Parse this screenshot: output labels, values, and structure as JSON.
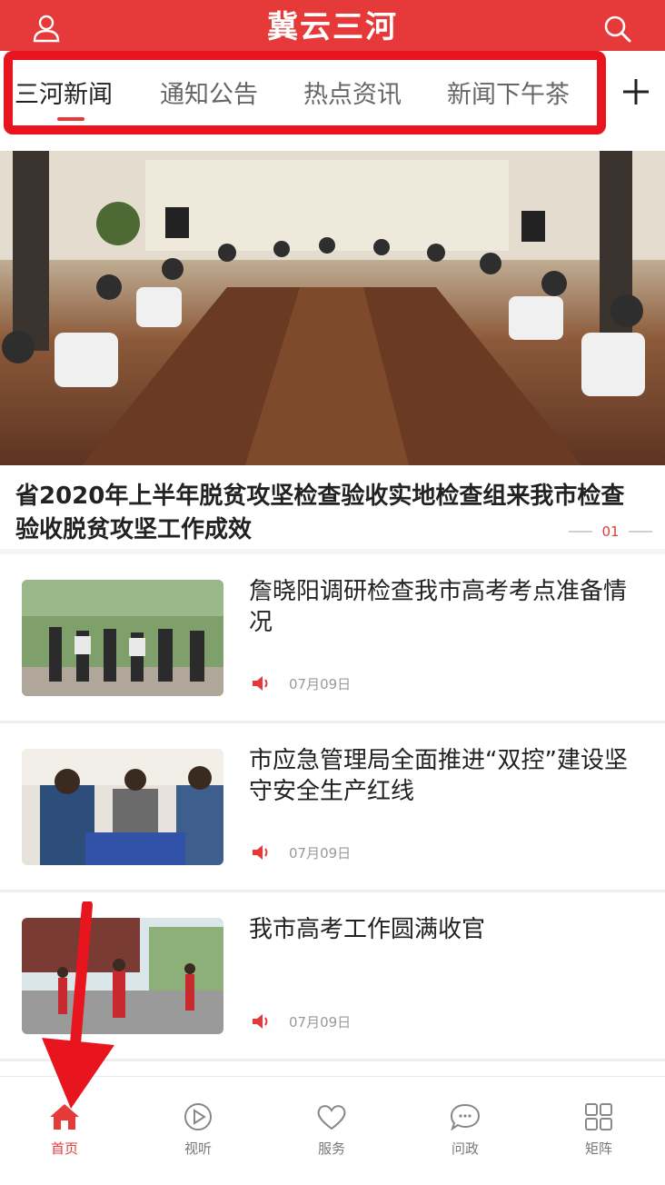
{
  "header": {
    "title": "冀云三河",
    "user_icon": "user-icon",
    "search_icon": "search-icon"
  },
  "tabs": [
    {
      "label": "三河新闻",
      "active": true
    },
    {
      "label": "通知公告",
      "active": false
    },
    {
      "label": "热点资讯",
      "active": false
    },
    {
      "label": "新闻下午茶",
      "active": false
    }
  ],
  "tabs_more_icon": "plus-icon",
  "hero": {
    "title": "省2020年上半年脱贫攻坚检查验收实地检查组来我市检查验收脱贫攻坚工作成效",
    "index": "01"
  },
  "news": [
    {
      "title": "詹晓阳调研检查我市高考考点准备情况",
      "date": "07月09日"
    },
    {
      "title": "市应急管理局全面推进“双控”建设坚守安全生产红线",
      "date": "07月09日"
    },
    {
      "title": "我市高考工作圆满收官",
      "date": "07月09日"
    }
  ],
  "bottom_nav": [
    {
      "label": "首页",
      "icon": "home-icon",
      "active": true
    },
    {
      "label": "视听",
      "icon": "play-icon",
      "active": false
    },
    {
      "label": "服务",
      "icon": "heart-icon",
      "active": false
    },
    {
      "label": "问政",
      "icon": "chat-icon",
      "active": false
    },
    {
      "label": "矩阵",
      "icon": "grid-icon",
      "active": false
    }
  ],
  "colors": {
    "brand": "#e63a3a",
    "highlight": "#e8141e"
  }
}
